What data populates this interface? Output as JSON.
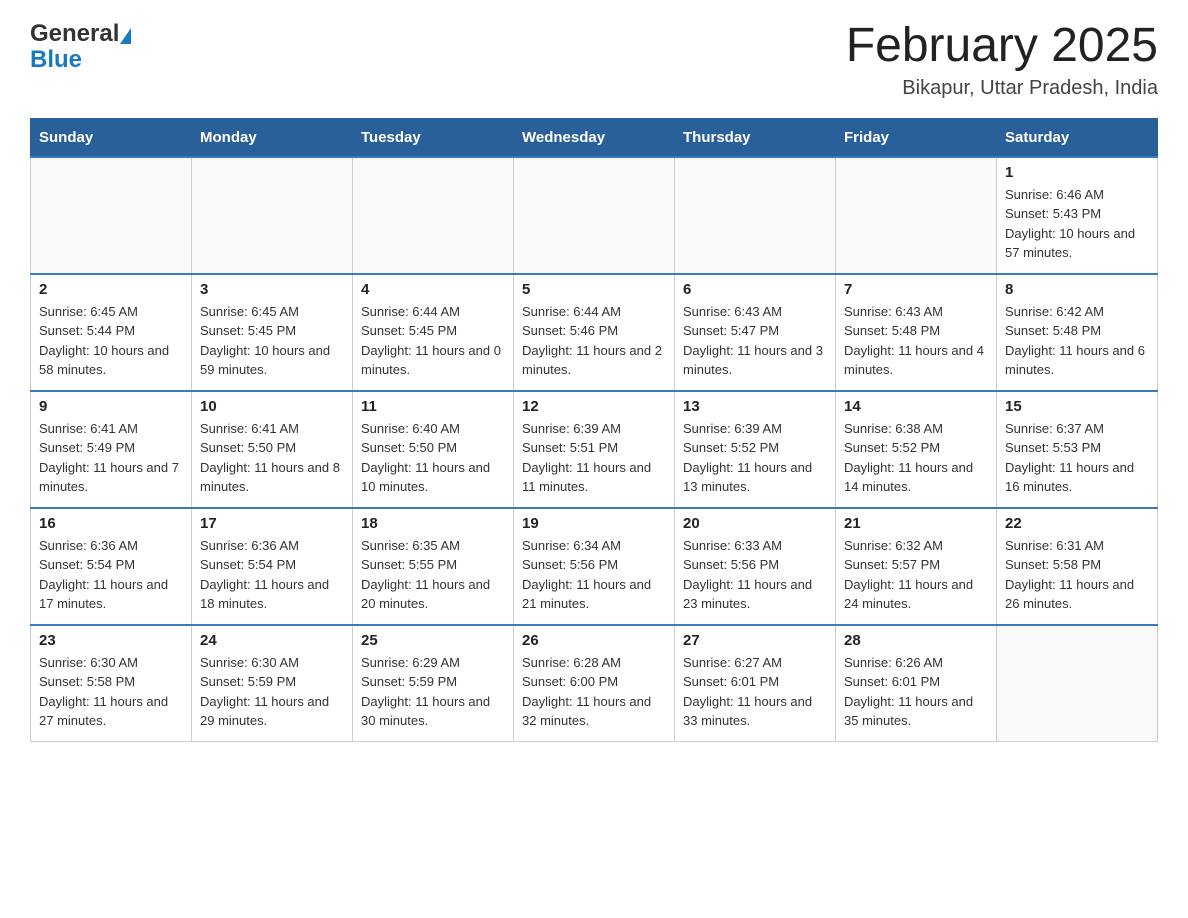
{
  "header": {
    "logo_general": "General",
    "logo_blue": "Blue",
    "title": "February 2025",
    "subtitle": "Bikapur, Uttar Pradesh, India"
  },
  "days_of_week": [
    "Sunday",
    "Monday",
    "Tuesday",
    "Wednesday",
    "Thursday",
    "Friday",
    "Saturday"
  ],
  "weeks": [
    [
      {
        "day": "",
        "info": ""
      },
      {
        "day": "",
        "info": ""
      },
      {
        "day": "",
        "info": ""
      },
      {
        "day": "",
        "info": ""
      },
      {
        "day": "",
        "info": ""
      },
      {
        "day": "",
        "info": ""
      },
      {
        "day": "1",
        "info": "Sunrise: 6:46 AM\nSunset: 5:43 PM\nDaylight: 10 hours and 57 minutes."
      }
    ],
    [
      {
        "day": "2",
        "info": "Sunrise: 6:45 AM\nSunset: 5:44 PM\nDaylight: 10 hours and 58 minutes."
      },
      {
        "day": "3",
        "info": "Sunrise: 6:45 AM\nSunset: 5:45 PM\nDaylight: 10 hours and 59 minutes."
      },
      {
        "day": "4",
        "info": "Sunrise: 6:44 AM\nSunset: 5:45 PM\nDaylight: 11 hours and 0 minutes."
      },
      {
        "day": "5",
        "info": "Sunrise: 6:44 AM\nSunset: 5:46 PM\nDaylight: 11 hours and 2 minutes."
      },
      {
        "day": "6",
        "info": "Sunrise: 6:43 AM\nSunset: 5:47 PM\nDaylight: 11 hours and 3 minutes."
      },
      {
        "day": "7",
        "info": "Sunrise: 6:43 AM\nSunset: 5:48 PM\nDaylight: 11 hours and 4 minutes."
      },
      {
        "day": "8",
        "info": "Sunrise: 6:42 AM\nSunset: 5:48 PM\nDaylight: 11 hours and 6 minutes."
      }
    ],
    [
      {
        "day": "9",
        "info": "Sunrise: 6:41 AM\nSunset: 5:49 PM\nDaylight: 11 hours and 7 minutes."
      },
      {
        "day": "10",
        "info": "Sunrise: 6:41 AM\nSunset: 5:50 PM\nDaylight: 11 hours and 8 minutes."
      },
      {
        "day": "11",
        "info": "Sunrise: 6:40 AM\nSunset: 5:50 PM\nDaylight: 11 hours and 10 minutes."
      },
      {
        "day": "12",
        "info": "Sunrise: 6:39 AM\nSunset: 5:51 PM\nDaylight: 11 hours and 11 minutes."
      },
      {
        "day": "13",
        "info": "Sunrise: 6:39 AM\nSunset: 5:52 PM\nDaylight: 11 hours and 13 minutes."
      },
      {
        "day": "14",
        "info": "Sunrise: 6:38 AM\nSunset: 5:52 PM\nDaylight: 11 hours and 14 minutes."
      },
      {
        "day": "15",
        "info": "Sunrise: 6:37 AM\nSunset: 5:53 PM\nDaylight: 11 hours and 16 minutes."
      }
    ],
    [
      {
        "day": "16",
        "info": "Sunrise: 6:36 AM\nSunset: 5:54 PM\nDaylight: 11 hours and 17 minutes."
      },
      {
        "day": "17",
        "info": "Sunrise: 6:36 AM\nSunset: 5:54 PM\nDaylight: 11 hours and 18 minutes."
      },
      {
        "day": "18",
        "info": "Sunrise: 6:35 AM\nSunset: 5:55 PM\nDaylight: 11 hours and 20 minutes."
      },
      {
        "day": "19",
        "info": "Sunrise: 6:34 AM\nSunset: 5:56 PM\nDaylight: 11 hours and 21 minutes."
      },
      {
        "day": "20",
        "info": "Sunrise: 6:33 AM\nSunset: 5:56 PM\nDaylight: 11 hours and 23 minutes."
      },
      {
        "day": "21",
        "info": "Sunrise: 6:32 AM\nSunset: 5:57 PM\nDaylight: 11 hours and 24 minutes."
      },
      {
        "day": "22",
        "info": "Sunrise: 6:31 AM\nSunset: 5:58 PM\nDaylight: 11 hours and 26 minutes."
      }
    ],
    [
      {
        "day": "23",
        "info": "Sunrise: 6:30 AM\nSunset: 5:58 PM\nDaylight: 11 hours and 27 minutes."
      },
      {
        "day": "24",
        "info": "Sunrise: 6:30 AM\nSunset: 5:59 PM\nDaylight: 11 hours and 29 minutes."
      },
      {
        "day": "25",
        "info": "Sunrise: 6:29 AM\nSunset: 5:59 PM\nDaylight: 11 hours and 30 minutes."
      },
      {
        "day": "26",
        "info": "Sunrise: 6:28 AM\nSunset: 6:00 PM\nDaylight: 11 hours and 32 minutes."
      },
      {
        "day": "27",
        "info": "Sunrise: 6:27 AM\nSunset: 6:01 PM\nDaylight: 11 hours and 33 minutes."
      },
      {
        "day": "28",
        "info": "Sunrise: 6:26 AM\nSunset: 6:01 PM\nDaylight: 11 hours and 35 minutes."
      },
      {
        "day": "",
        "info": ""
      }
    ]
  ]
}
